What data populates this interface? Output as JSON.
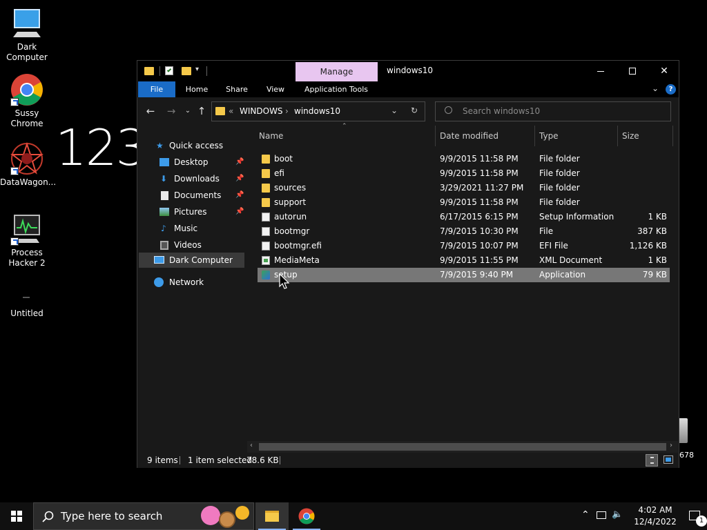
{
  "desktop": {
    "icons": [
      {
        "label": "Dark Computer"
      },
      {
        "label": "Sussy Chrome"
      },
      {
        "label": "DataWagon..."
      },
      {
        "label": "Process Hacker 2"
      },
      {
        "label": "Untitled"
      }
    ],
    "big_text": "123",
    "recycle_label": "678"
  },
  "window": {
    "title": "windows10",
    "manage_tab": "Manage",
    "ribbon_tabs": [
      "File",
      "Home",
      "Share",
      "View",
      "Application Tools"
    ],
    "address": {
      "prefix": "«",
      "segments": [
        "WINDOWS",
        "windows10"
      ]
    },
    "search_placeholder": "Search windows10",
    "nav": {
      "quick_access": "Quick access",
      "items": [
        "Desktop",
        "Downloads",
        "Documents",
        "Pictures",
        "Music",
        "Videos"
      ],
      "this_pc": "Dark Computer",
      "network": "Network"
    },
    "columns": [
      "Name",
      "Date modified",
      "Type",
      "Size"
    ],
    "files": [
      {
        "name": "boot",
        "date": "9/9/2015 11:58 PM",
        "type": "File folder",
        "size": "",
        "icon": "folder-icon"
      },
      {
        "name": "efi",
        "date": "9/9/2015 11:58 PM",
        "type": "File folder",
        "size": "",
        "icon": "folder-icon"
      },
      {
        "name": "sources",
        "date": "3/29/2021 11:27 PM",
        "type": "File folder",
        "size": "",
        "icon": "folder-icon"
      },
      {
        "name": "support",
        "date": "9/9/2015 11:58 PM",
        "type": "File folder",
        "size": "",
        "icon": "folder-icon"
      },
      {
        "name": "autorun",
        "date": "6/17/2015 6:15 PM",
        "type": "Setup Information",
        "size": "1 KB",
        "icon": "settings-file-icon"
      },
      {
        "name": "bootmgr",
        "date": "7/9/2015 10:30 PM",
        "type": "File",
        "size": "387 KB",
        "icon": "file-icon"
      },
      {
        "name": "bootmgr.efi",
        "date": "7/9/2015 10:07 PM",
        "type": "EFI File",
        "size": "1,126 KB",
        "icon": "file-icon"
      },
      {
        "name": "MediaMeta",
        "date": "9/9/2015 11:55 PM",
        "type": "XML Document",
        "size": "1 KB",
        "icon": "xml-file-icon"
      },
      {
        "name": "setup",
        "date": "7/9/2015 9:40 PM",
        "type": "Application",
        "size": "79 KB",
        "icon": "application-icon"
      }
    ],
    "selected_index": 8,
    "status": {
      "count": "9 items",
      "selected": "1 item selected",
      "size": "78.6 KB"
    }
  },
  "taskbar": {
    "search_placeholder": "Type here to search",
    "time": "4:02 AM",
    "date": "12/4/2022",
    "notification_count": "1"
  },
  "colors": {
    "accent": "#1a6cc7",
    "manage_tab": "#e8c6f0",
    "selection": "#777777",
    "folder": "#f5c94a"
  }
}
